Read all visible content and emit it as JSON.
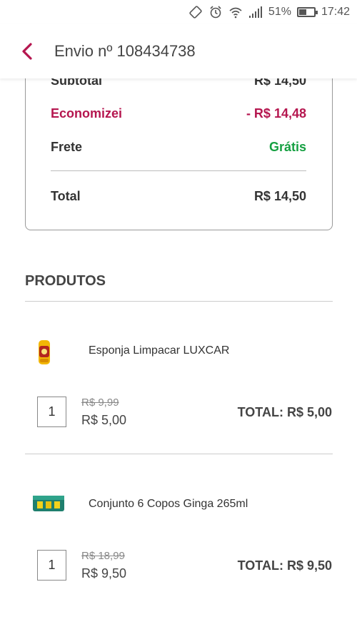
{
  "status_bar": {
    "battery": "51%",
    "time": "17:42",
    "icons": [
      "vibrate-icon",
      "alarm-icon",
      "wifi-icon",
      "signal-icon",
      "battery-icon"
    ]
  },
  "header": {
    "title": "Envio nº 108434738",
    "accent_color": "#b5164f"
  },
  "summary": {
    "subtotal_label": "Subtotal",
    "subtotal_value": "R$ 14,50",
    "econ_label": "Economizei",
    "econ_value": "- R$ 14,48",
    "frete_label": "Frete",
    "frete_value": "Grátis",
    "total_label": "Total",
    "total_value": "R$ 14,50"
  },
  "products": {
    "title": "PRODUTOS",
    "items": [
      {
        "name": "Esponja Limpacar LUXCAR",
        "qty": "1",
        "old_price": "R$ 9,99",
        "new_price": "R$ 5,00",
        "total": "TOTAL: R$ 5,00"
      },
      {
        "name": "Conjunto 6 Copos Ginga 265ml",
        "qty": "1",
        "old_price": "R$ 18,99",
        "new_price": "R$ 9,50",
        "total": "TOTAL: R$ 9,50"
      }
    ]
  }
}
